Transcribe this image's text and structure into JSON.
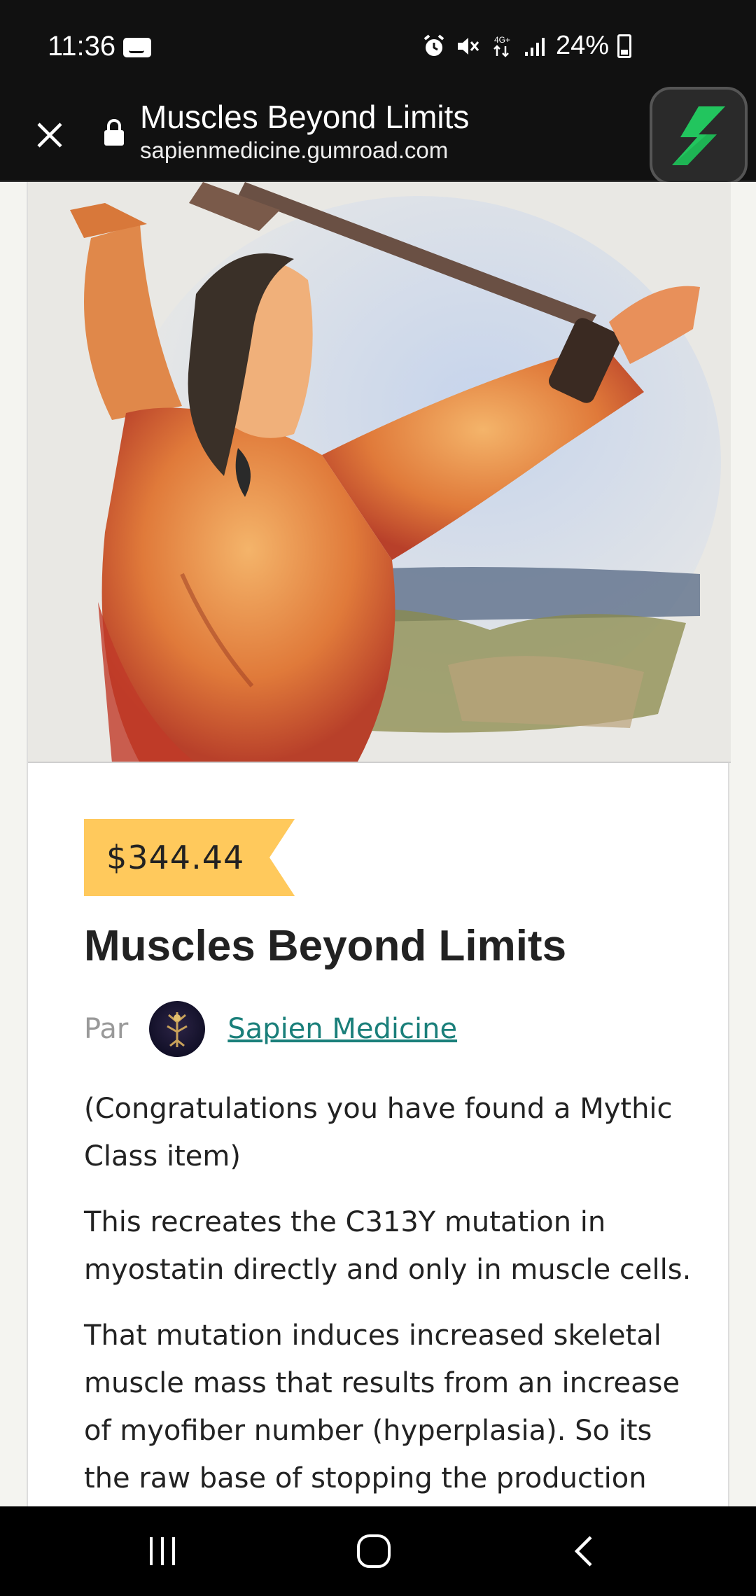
{
  "status_bar": {
    "time": "11:36",
    "battery": "24%",
    "network": "4G+"
  },
  "browser": {
    "page_title": "Muscles Beyond Limits",
    "url": "sapienmedicine.gumroad.com"
  },
  "product": {
    "price": "$344.44",
    "title": "Muscles Beyond Limits",
    "by_label": "Par",
    "author": "Sapien Medicine",
    "description": [
      "(Congratulations you have found a Mythic Class item)",
      "This recreates the C313Y mutation in myostatin directly and only in muscle cells.",
      "That mutation induces increased skeletal muscle mass that results from an increase of myofiber number (hyperplasia). So its the raw base of stopping the production"
    ]
  },
  "colors": {
    "price_tag": "#ffc95c",
    "author_link": "#1a7f7a",
    "extension_accent": "#22c55e"
  },
  "icons": {
    "close": "close-icon",
    "lock": "lock-icon",
    "extension": "lightning-bolt-icon",
    "nav_recent": "recent-apps-icon",
    "nav_home": "home-icon",
    "nav_back": "back-icon"
  }
}
